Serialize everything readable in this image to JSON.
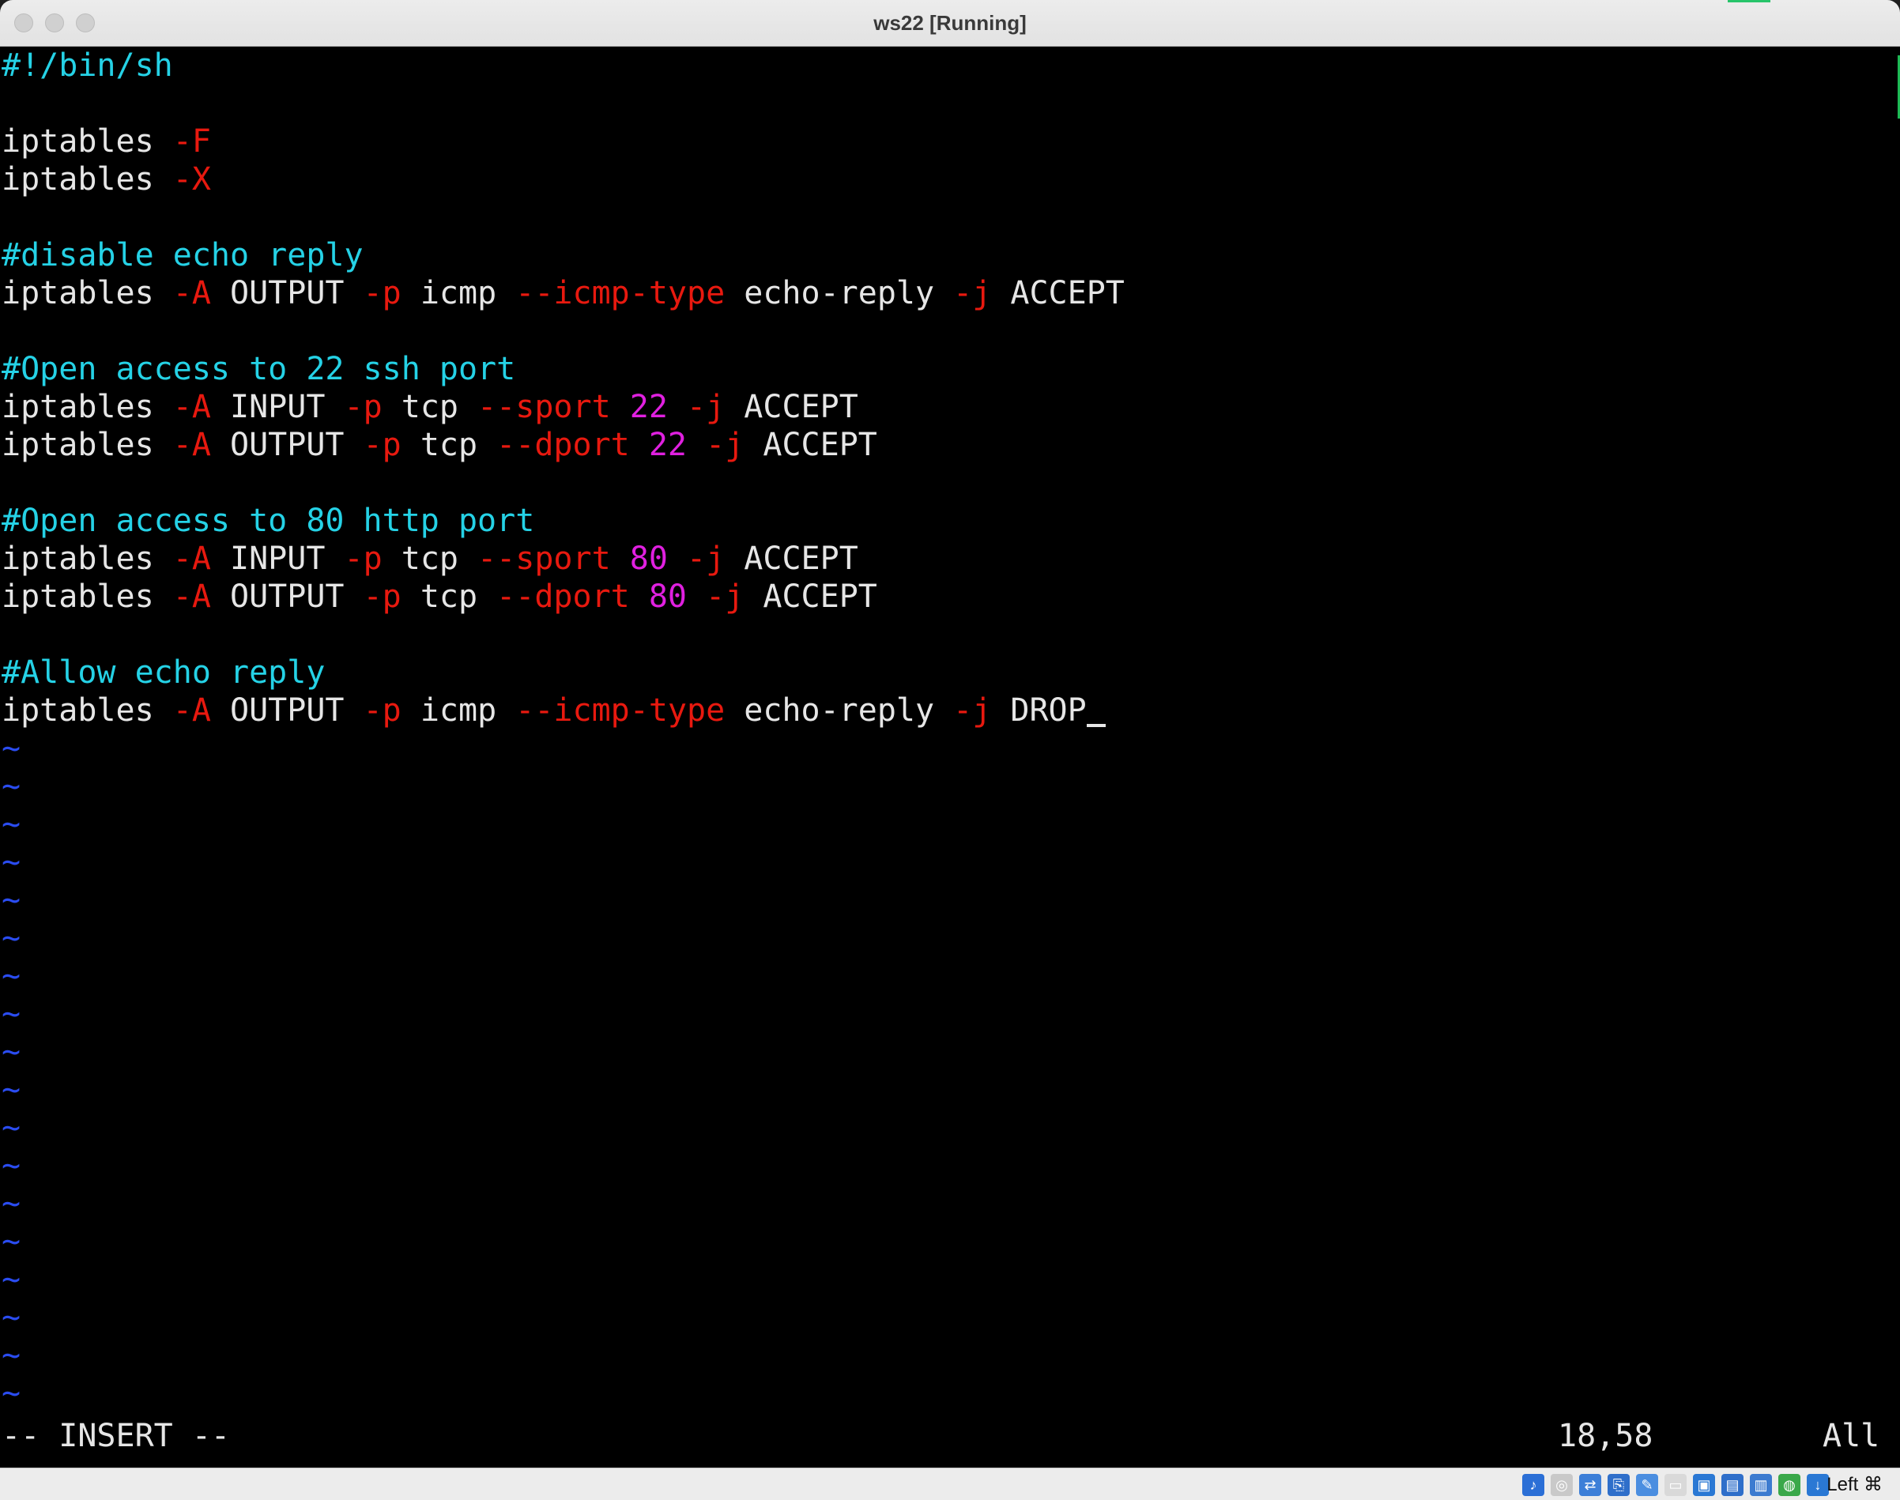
{
  "window": {
    "title": "ws22 [Running]"
  },
  "editor": {
    "lines": [
      [
        [
          "#!/bin/sh",
          "cmt"
        ]
      ],
      [],
      [
        [
          "iptables ",
          "cmd"
        ],
        [
          "-F",
          "opt"
        ]
      ],
      [
        [
          "iptables ",
          "cmd"
        ],
        [
          "-X",
          "opt"
        ]
      ],
      [],
      [
        [
          "#disable echo reply",
          "cmt"
        ]
      ],
      [
        [
          "iptables ",
          "cmd"
        ],
        [
          "-A",
          "opt"
        ],
        [
          " OUTPUT ",
          "cmd"
        ],
        [
          "-p",
          "opt"
        ],
        [
          " icmp ",
          "cmd"
        ],
        [
          "--icmp-type",
          "opt"
        ],
        [
          " echo-reply ",
          "cmd"
        ],
        [
          "-j",
          "opt"
        ],
        [
          " ACCEPT",
          "cmd"
        ]
      ],
      [],
      [
        [
          "#Open access to 22 ssh port",
          "cmt"
        ]
      ],
      [
        [
          "iptables ",
          "cmd"
        ],
        [
          "-A",
          "opt"
        ],
        [
          " INPUT ",
          "cmd"
        ],
        [
          "-p",
          "opt"
        ],
        [
          " tcp ",
          "cmd"
        ],
        [
          "--sport",
          "opt"
        ],
        [
          " ",
          "cmd"
        ],
        [
          "22",
          "num"
        ],
        [
          " ",
          "cmd"
        ],
        [
          "-j",
          "opt"
        ],
        [
          " ACCEPT",
          "cmd"
        ]
      ],
      [
        [
          "iptables ",
          "cmd"
        ],
        [
          "-A",
          "opt"
        ],
        [
          " OUTPUT ",
          "cmd"
        ],
        [
          "-p",
          "opt"
        ],
        [
          " tcp ",
          "cmd"
        ],
        [
          "--dport",
          "opt"
        ],
        [
          " ",
          "cmd"
        ],
        [
          "22",
          "num"
        ],
        [
          " ",
          "cmd"
        ],
        [
          "-j",
          "opt"
        ],
        [
          " ACCEPT",
          "cmd"
        ]
      ],
      [],
      [
        [
          "#Open access to 80 http port",
          "cmt"
        ]
      ],
      [
        [
          "iptables ",
          "cmd"
        ],
        [
          "-A",
          "opt"
        ],
        [
          " INPUT ",
          "cmd"
        ],
        [
          "-p",
          "opt"
        ],
        [
          " tcp ",
          "cmd"
        ],
        [
          "--sport",
          "opt"
        ],
        [
          " ",
          "cmd"
        ],
        [
          "80",
          "num"
        ],
        [
          " ",
          "cmd"
        ],
        [
          "-j",
          "opt"
        ],
        [
          " ACCEPT",
          "cmd"
        ]
      ],
      [
        [
          "iptables ",
          "cmd"
        ],
        [
          "-A",
          "opt"
        ],
        [
          " OUTPUT ",
          "cmd"
        ],
        [
          "-p",
          "opt"
        ],
        [
          " tcp ",
          "cmd"
        ],
        [
          "--dport",
          "opt"
        ],
        [
          " ",
          "cmd"
        ],
        [
          "80",
          "num"
        ],
        [
          " ",
          "cmd"
        ],
        [
          "-j",
          "opt"
        ],
        [
          " ACCEPT",
          "cmd"
        ]
      ],
      [],
      [
        [
          "#Allow echo reply",
          "cmt"
        ]
      ],
      [
        [
          "iptables ",
          "cmd"
        ],
        [
          "-A",
          "opt"
        ],
        [
          " OUTPUT ",
          "cmd"
        ],
        [
          "-p",
          "opt"
        ],
        [
          " icmp ",
          "cmd"
        ],
        [
          "--icmp-type",
          "opt"
        ],
        [
          " echo-reply ",
          "cmd"
        ],
        [
          "-j",
          "opt"
        ],
        [
          " DROP",
          "cmd"
        ]
      ]
    ],
    "tilde_lines": [
      "~",
      "~",
      "~",
      "~",
      "~",
      "~",
      "~",
      "~",
      "~",
      "~",
      "~",
      "~",
      "~",
      "~",
      "~",
      "~",
      "~",
      "~"
    ],
    "status": {
      "mode": "-- INSERT --",
      "position": "18,58",
      "scroll": "All"
    }
  },
  "statusbar": {
    "icons": [
      "audio-icon",
      "optical-drive-icon",
      "network-icon",
      "usb-icon",
      "shared-folder-icon",
      "display-icon",
      "screen-capture-icon",
      "vm-window-icon",
      "cpu-icon",
      "globe-icon",
      "download-icon"
    ],
    "host_key": "Left ⌘"
  },
  "colors": {
    "command": "#e6e6e6",
    "option": "#e8190f",
    "number": "#e020e0",
    "comment": "#25d2e6",
    "tilde": "#2a4cf0"
  }
}
